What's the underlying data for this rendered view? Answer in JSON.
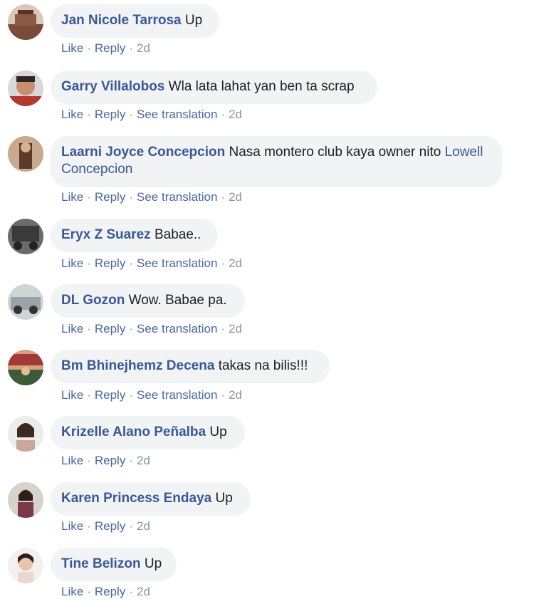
{
  "actions": {
    "like": "Like",
    "reply": "Reply",
    "see_translation": "See translation",
    "separator": "·"
  },
  "comments": [
    {
      "author": "Jan Nicole Tarrosa",
      "text": "Up",
      "time": "2d",
      "translation": false,
      "avatar_color": "#7a4a3a"
    },
    {
      "author": "Garry Villalobos",
      "text": "Wla lata lahat yan ben ta scrap",
      "time": "2d",
      "translation": true,
      "avatar_color": "#b33a2e"
    },
    {
      "author": "Laarni Joyce Concepcion",
      "text": "Nasa montero club kaya owner nito",
      "mention": "Lowell Concepcion",
      "time": "2d",
      "translation": true,
      "avatar_color": "#5a3b2b"
    },
    {
      "author": "Eryx Z Suarez",
      "text": "Babae..",
      "time": "2d",
      "translation": true,
      "avatar_color": "#3a3a3a"
    },
    {
      "author": "DL Gozon",
      "text": "Wow. Babae pa.",
      "time": "2d",
      "translation": true,
      "avatar_color": "#9aa3a8"
    },
    {
      "author": "Bm Bhinejhemz Decena",
      "text": "takas na bilis!!!",
      "time": "2d",
      "translation": true,
      "avatar_color": "#a33a3a"
    },
    {
      "author": "Krizelle Alano Peñalba",
      "text": "Up",
      "time": "2d",
      "translation": false,
      "avatar_color": "#c9a89a"
    },
    {
      "author": "Karen Princess Endaya",
      "text": "Up",
      "time": "2d",
      "translation": false,
      "avatar_color": "#7a3a4a"
    },
    {
      "author": "Tine Belizon",
      "text": "Up",
      "time": "2d",
      "translation": false,
      "avatar_color": "#e8d8d0"
    }
  ]
}
